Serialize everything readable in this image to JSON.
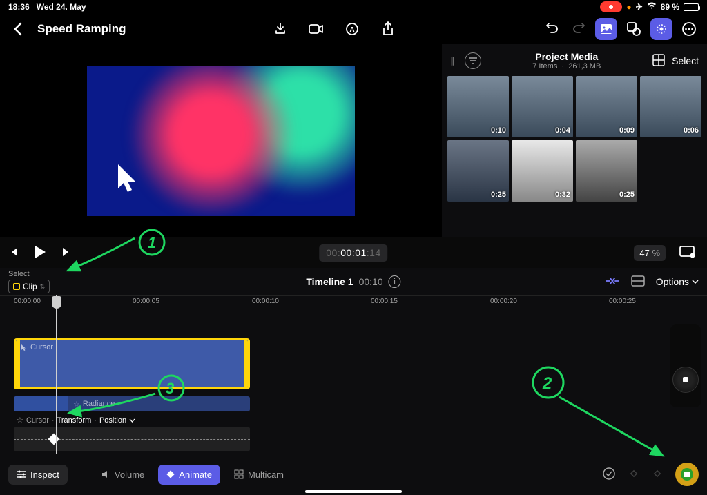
{
  "status_bar": {
    "time": "18:36",
    "date": "Wed 24. May",
    "battery_pct": "89 %"
  },
  "header": {
    "title": "Speed Ramping"
  },
  "media": {
    "title": "Project Media",
    "items_label": "7 Items",
    "size_label": "261,3 MB",
    "select_label": "Select",
    "thumbs": [
      {
        "duration": "0:10"
      },
      {
        "duration": "0:04"
      },
      {
        "duration": "0:09"
      },
      {
        "duration": "0:06"
      },
      {
        "duration": "0:25"
      },
      {
        "duration": "0:32"
      },
      {
        "duration": "0:25"
      }
    ]
  },
  "transport": {
    "timecode_prefix": "00:",
    "timecode_main": "00:01",
    "timecode_frames": ":14",
    "zoom_value": "47",
    "zoom_unit": "%"
  },
  "timeline": {
    "select_label": "Select",
    "clip_chip": "Clip",
    "title": "Timeline 1",
    "duration": "00:10",
    "options_label": "Options",
    "ruler": [
      "00:00:00",
      "00:00:05",
      "00:00:10",
      "00:00:15",
      "00:00:20",
      "00:00:25"
    ],
    "clip_main_name": "Cursor",
    "clip_sub_name": "Radiance",
    "keyframe_label_parts": {
      "clip": "Cursor",
      "sep1": " · ",
      "category": "Transform",
      "sep2": " · ",
      "param": "Position"
    }
  },
  "bottom": {
    "inspect": "Inspect",
    "volume": "Volume",
    "animate": "Animate",
    "multicam": "Multicam"
  },
  "annotations": {
    "one": "1",
    "two": "2",
    "three": "3"
  }
}
